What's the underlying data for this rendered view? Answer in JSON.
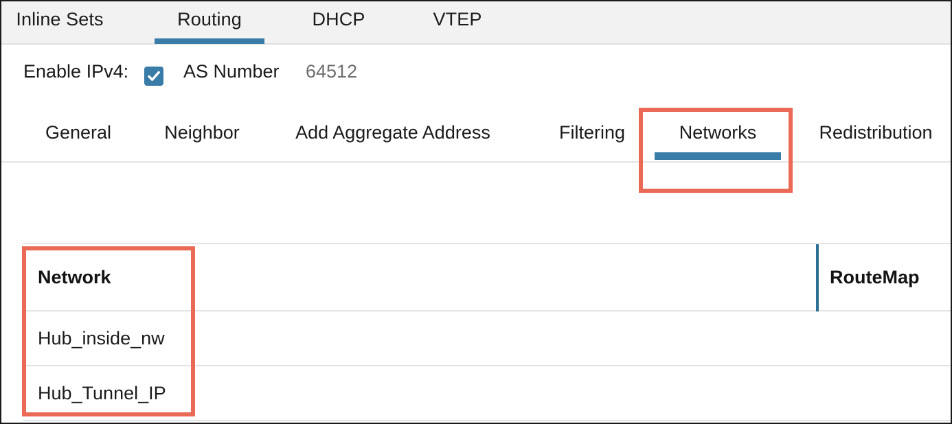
{
  "top_tabs": [
    {
      "label": "Inline Sets",
      "active": false
    },
    {
      "label": "Routing",
      "active": true
    },
    {
      "label": "DHCP",
      "active": false
    },
    {
      "label": "VTEP",
      "active": false
    }
  ],
  "enable_row": {
    "enable_label": "Enable IPv4:",
    "checkbox_checked": true,
    "checkbox_icon": "checkmark-icon",
    "as_label": "AS Number",
    "as_value": "64512"
  },
  "sub_tabs": [
    {
      "label": "General",
      "active": false
    },
    {
      "label": "Neighbor",
      "active": false
    },
    {
      "label": "Add Aggregate Address",
      "active": false
    },
    {
      "label": "Filtering",
      "active": false
    },
    {
      "label": "Networks",
      "active": true
    },
    {
      "label": "Redistribution",
      "active": false
    }
  ],
  "table": {
    "columns": [
      "Network",
      "RouteMap"
    ],
    "rows": [
      {
        "network": "Hub_inside_nw",
        "routemap": ""
      },
      {
        "network": "Hub_Tunnel_IP",
        "routemap": ""
      }
    ]
  },
  "colors": {
    "accent_blue": "#3a7ca8",
    "annotation_red": "#ea6a55",
    "tabbar_bg": "#f2f2f2",
    "border_gray": "#e4e4e4",
    "value_gray": "#6e6e6e"
  }
}
